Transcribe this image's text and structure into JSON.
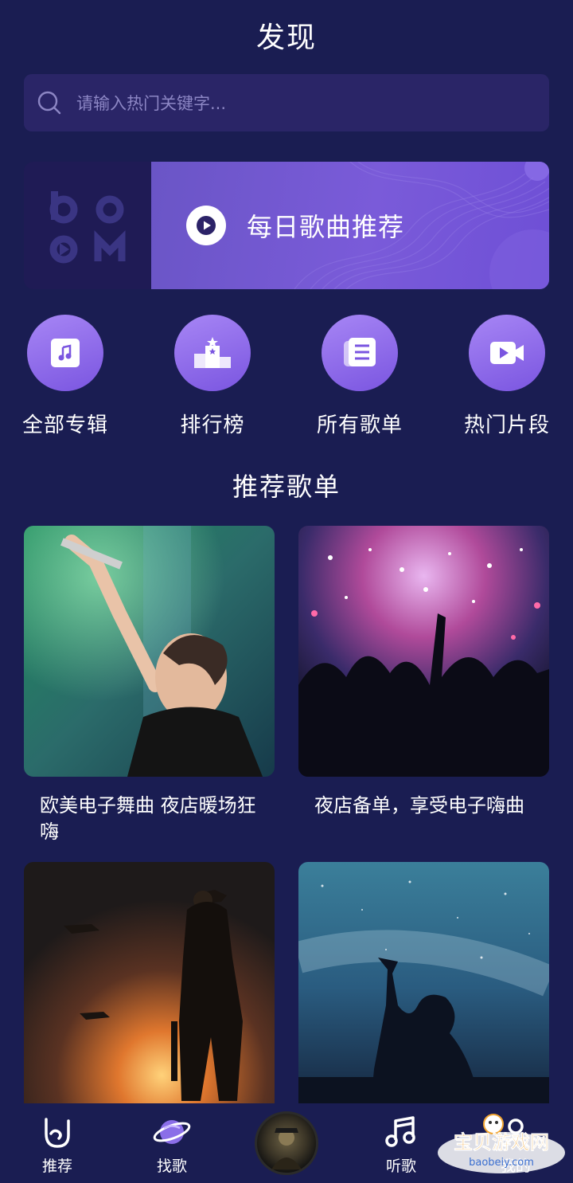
{
  "header": {
    "title": "发现"
  },
  "search": {
    "placeholder": "请输入热门关键字..."
  },
  "banner": {
    "logo_text": "boom",
    "label": "每日歌曲推荐"
  },
  "quick_links": [
    {
      "label": "全部专辑",
      "icon": "album-music-icon"
    },
    {
      "label": "排行榜",
      "icon": "podium-icon"
    },
    {
      "label": "所有歌单",
      "icon": "playlist-icon"
    },
    {
      "label": "热门片段",
      "icon": "video-clip-icon"
    }
  ],
  "section": {
    "title": "推荐歌单"
  },
  "playlists": [
    {
      "title": "欧美电子舞曲 夜店暖场狂嗨",
      "image": "singer-on-stage-photo"
    },
    {
      "title": "夜店备单，享受电子嗨曲",
      "image": "concert-crowd-photo"
    },
    {
      "title": "",
      "image": "soldier-explosion-photo"
    },
    {
      "title": "",
      "image": "starry-sky-silhouette-photo"
    }
  ],
  "tabbar": {
    "items": [
      {
        "label": "推荐",
        "icon": "rock-hand-icon"
      },
      {
        "label": "找歌",
        "icon": "planet-icon"
      },
      {
        "label": "",
        "icon": "now-playing-disc"
      },
      {
        "label": "听歌",
        "icon": "music-note-icon"
      },
      {
        "label": "我的",
        "icon": "profile-icon"
      }
    ]
  },
  "watermark": {
    "text": "宝贝游戏网",
    "url_text": "baobeiy.com"
  },
  "colors": {
    "background": "#1a1d52",
    "accent": "#7a55e0",
    "search_bg": "#2a2567"
  }
}
